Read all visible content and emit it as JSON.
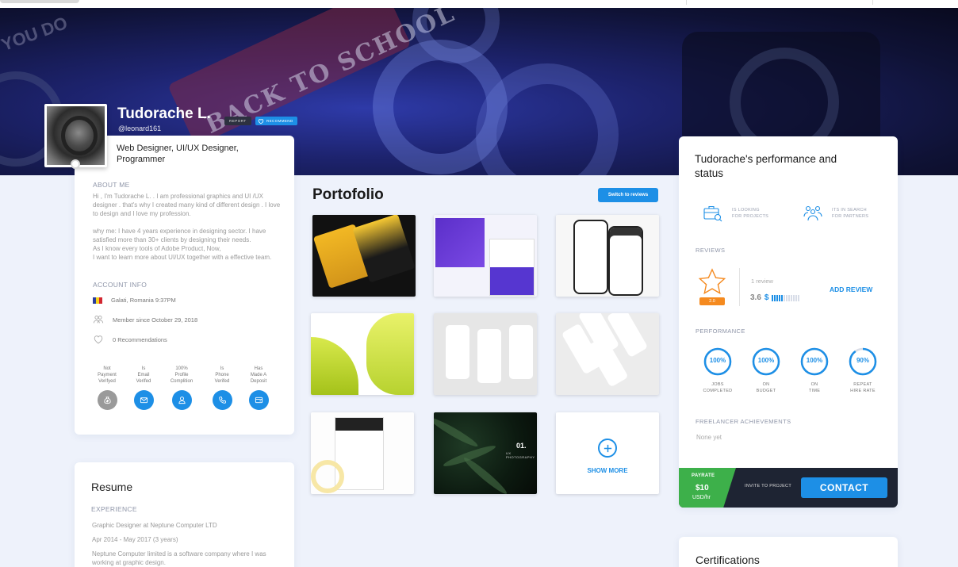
{
  "profile": {
    "name": "Tudorache L.",
    "handle": "@leonard161",
    "report_label": "REPORT",
    "recommend_label": "RECOMMEND",
    "roles": "Web Designer, UI/UX Designer, Programmer"
  },
  "about": {
    "heading": "ABOUT ME",
    "text": "Hi , I'm Tudorache L. . I am professional graphics and UI /UX designer . that's why I created many kind of different design . I love to design and I love my profession.\n\nwhy me: I have 4 years experience in designing sector. I have satisfied more than 30+ clients by designing their needs.\nAs I know every tools of Adobe Product, Now,\nI want to learn more about UI/UX together with a effective team."
  },
  "account_info": {
    "heading": "ACCOUNT INFO",
    "location": "Galati, Romania 9:37PM",
    "member_since": "Member since October 29, 2018",
    "recommendations": "0 Recommendations"
  },
  "verifications": [
    {
      "label": "Not\nPayment\nVerifyed",
      "icon": "money-bag-icon",
      "active": false
    },
    {
      "label": "Is\nEmail\nVerifed",
      "icon": "email-icon",
      "active": true
    },
    {
      "label": "100%\nProfile\nComplition",
      "icon": "user-icon",
      "active": true
    },
    {
      "label": "Is\nPhone\nVerifed",
      "icon": "phone-icon",
      "active": true
    },
    {
      "label": "Has\nMade A\nDeposit",
      "icon": "wallet-icon",
      "active": true
    }
  ],
  "resume": {
    "title": "Resume",
    "experience_heading": "EXPERIENCE",
    "job_title": "Graphic Designer at Neptune Computer LTD",
    "job_period": "Apr 2014 - May 2017 (3 years)",
    "job_desc": "Neptune Computer limited is a software company where I was working at graphic design."
  },
  "portfolio": {
    "title": "Portofolio",
    "switch_label": "Switch to reviews",
    "show_more": "SHOW MORE",
    "thumb8_big": "01.",
    "thumb8_small": "UX PHOTOGRAPHY"
  },
  "performance": {
    "title": "Tudorache's performance and status",
    "status": [
      {
        "text": "IS LOOKING\nFOR PROJECTS",
        "icon": "briefcase-search-icon"
      },
      {
        "text": "ITS IN SEARCH\nFOR PARTNERS",
        "icon": "team-icon"
      }
    ],
    "reviews_heading": "REVIEWS",
    "star_badge": "2.0",
    "review_count": "1 review",
    "review_score": "3.6",
    "review_score_fraction": 0.4,
    "add_review": "ADD REVIEW",
    "performance_heading": "PERFORMANCE",
    "gauges": [
      {
        "value": "100%",
        "fraction": 1.0,
        "label": "JOBS\nCOMPLETED"
      },
      {
        "value": "100%",
        "fraction": 1.0,
        "label": "ON\nBUDGET"
      },
      {
        "value": "100%",
        "fraction": 1.0,
        "label": "ON\nTIME"
      },
      {
        "value": "90%",
        "fraction": 0.9,
        "label": "REPEAT\nHIRE RATE"
      }
    ],
    "achievements_heading": "FREELANCER ACHIEVEMENTS",
    "achievements_none": "None yet"
  },
  "contact": {
    "payrate_label": "PAYRATE",
    "payrate_value": "$10",
    "payrate_unit": "USD/hr",
    "invite_label": "INVITE TO PROJECT",
    "contact_label": "CONTACT"
  },
  "certifications": {
    "title": "Certifications"
  },
  "hero": {
    "pennant_text": "BACK TO SCHOOL",
    "corner_text": "YOU DO"
  },
  "colors": {
    "accent": "#1d8fe6",
    "success": "#3db04a",
    "dark": "#1e2433",
    "star_badge": "#f58a1f"
  }
}
